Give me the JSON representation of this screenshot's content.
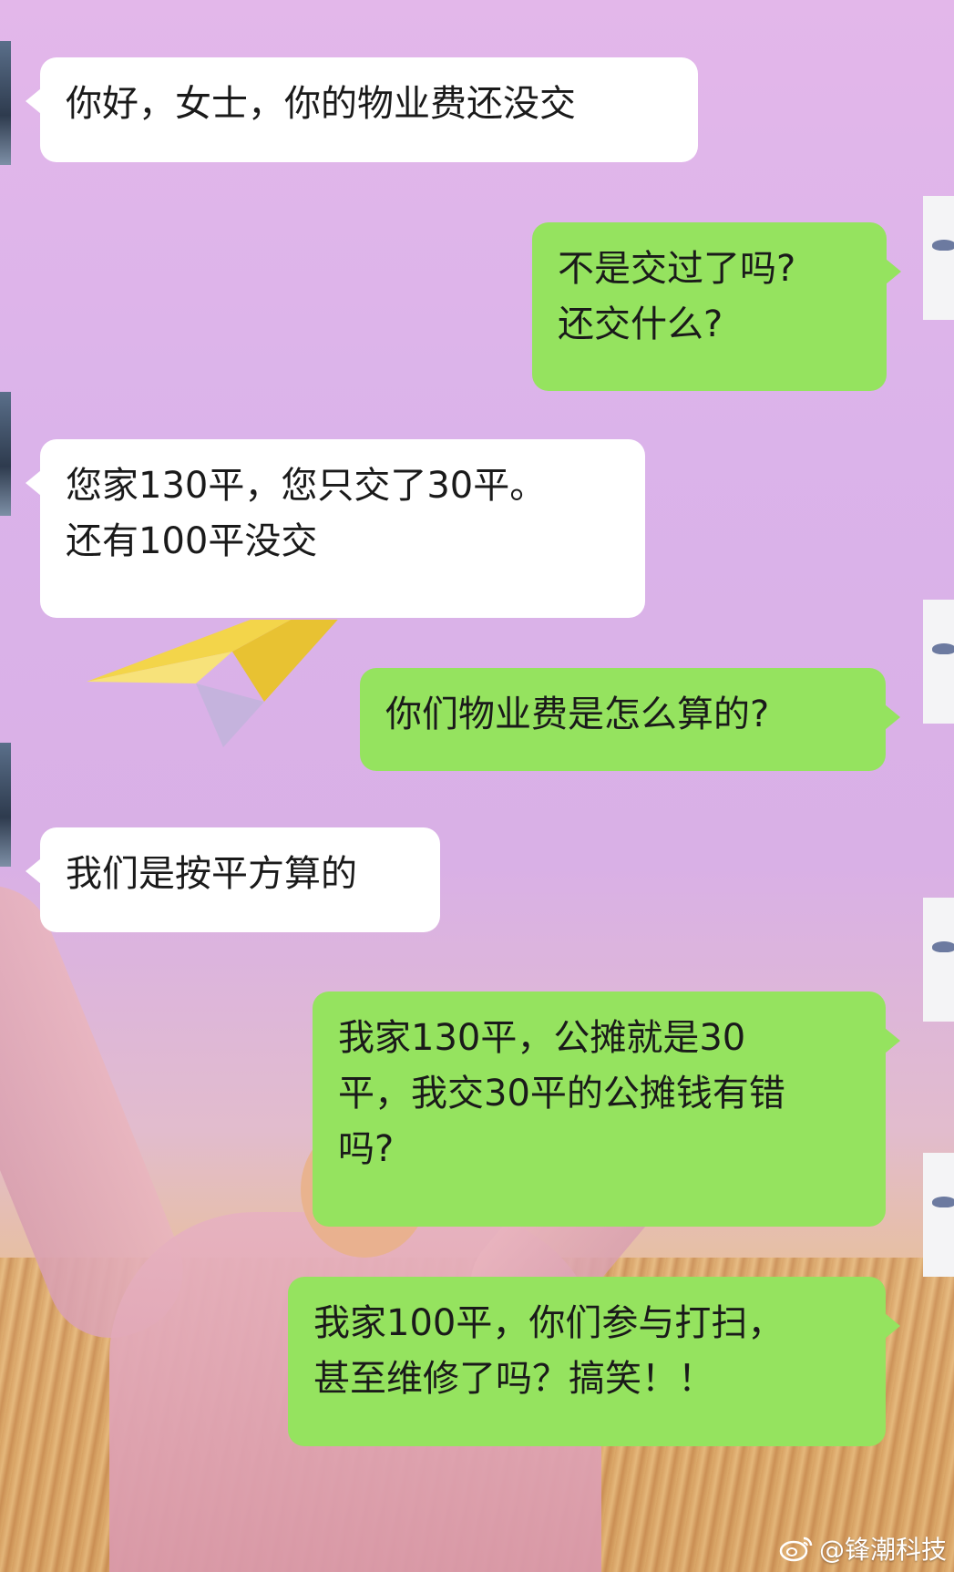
{
  "chat": {
    "messages": [
      {
        "side": "received",
        "text": "你好，女士，你的物业费还没交"
      },
      {
        "side": "sent",
        "text": "不是交过了吗?\n还交什么?"
      },
      {
        "side": "received",
        "text": "您家130平，您只交了30平。\n还有100平没交"
      },
      {
        "side": "sent",
        "text": "你们物业费是怎么算的?"
      },
      {
        "side": "received",
        "text": "我们是按平方算的"
      },
      {
        "side": "sent",
        "text": "我家130平，公摊就是30\n平，我交30平的公摊钱有错\n吗?"
      },
      {
        "side": "sent",
        "text": "我家100平，你们参与打扫，\n甚至维修了吗？搞笑！！"
      }
    ]
  },
  "watermark": {
    "text": "@锋潮科技",
    "icon": "weibo-icon"
  },
  "colors": {
    "sent_bubble": "#95e35f",
    "received_bubble": "#ffffff",
    "background": "#dbb3ea"
  }
}
